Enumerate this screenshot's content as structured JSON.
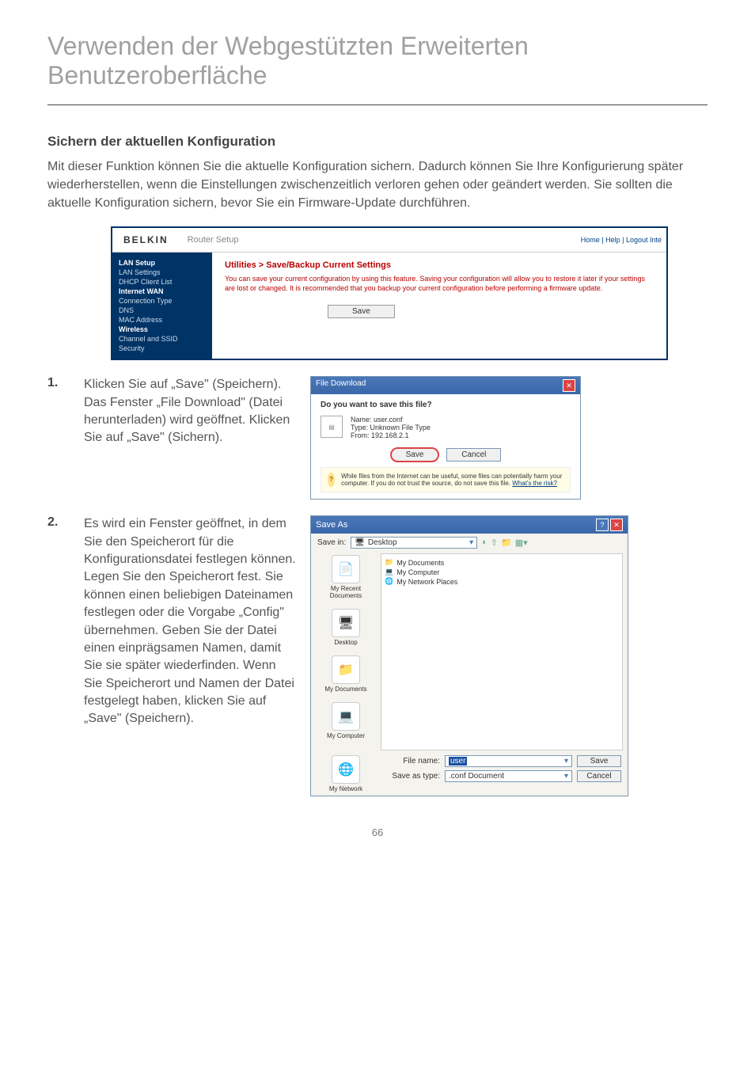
{
  "title_line1": "Verwenden der Webgestützten Erweiterten",
  "title_line2": "Benutzeroberfläche",
  "section_heading": "Sichern der aktuellen Konfiguration",
  "intro": "Mit dieser Funktion können Sie die aktuelle Konfiguration sichern. Dadurch können Sie Ihre Konfigurierung später wiederherstellen, wenn die Einstellungen zwischenzeitlich verloren gehen oder geändert werden. Sie sollten die aktuelle Konfiguration sichern, bevor Sie ein Firmware-Update durchführen.",
  "router": {
    "logo": "BELKIN",
    "title": "Router Setup",
    "links": "Home | Help | Logout    Inte",
    "side": {
      "hd1": "LAN Setup",
      "i1": "LAN Settings",
      "i2": "DHCP Client List",
      "hd2": "Internet WAN",
      "i3": "Connection Type",
      "i4": "DNS",
      "i5": "MAC Address",
      "hd3": "Wireless",
      "i6": "Channel and SSID",
      "i7": "Security"
    },
    "panel_title": "Utilities > Save/Backup Current Settings",
    "panel_text": "You can save your current configuration by using this feature. Saving your configuration will allow you to restore it later if your settings are lost or changed. It is recommended that you backup your current configuration before performing a firmware update.",
    "save": "Save"
  },
  "step1_num": "1.",
  "step1": "Klicken Sie auf „Save\" (Speichern). Das Fenster „File Download\" (Datei herunterladen) wird geöffnet. Klicken Sie auf „Save\" (Sichern).",
  "fdl": {
    "title": "File Download",
    "question": "Do you want to save this file?",
    "name_lbl": "Name:",
    "name_val": "user.conf",
    "type_lbl": "Type:",
    "type_val": "Unknown File Type",
    "from_lbl": "From:",
    "from_val": "192.168.2.1",
    "save": "Save",
    "cancel": "Cancel",
    "warn": "While files from the Internet can be useful, some files can potentially harm your computer. If you do not trust the source, do not save this file.",
    "warn_link": "What's the risk?"
  },
  "step2_num": "2.",
  "step2": "Es wird ein Fenster geöffnet, in dem Sie den Speicherort für die Konfigurationsdatei festlegen können. Legen Sie den Speicherort fest. Sie können einen beliebigen Dateinamen festlegen oder die Vorgabe „Config\" übernehmen. Geben Sie der Datei einen einprägsamen Namen, damit Sie sie später wiederfinden. Wenn Sie Speicherort und Namen der Datei festgelegt haben, klicken Sie auf „Save\" (Speichern).",
  "saveas": {
    "title": "Save As",
    "savein_lbl": "Save in:",
    "savein_val": "Desktop",
    "itm1": "My Documents",
    "itm2": "My Computer",
    "itm3": "My Network Places",
    "p1": "My Recent Documents",
    "p2": "Desktop",
    "p3": "My Documents",
    "p4": "My Computer",
    "p5": "My Network",
    "fn_lbl": "File name:",
    "fn_val": "user",
    "ft_lbl": "Save as type:",
    "ft_val": ".conf Document",
    "save": "Save",
    "cancel": "Cancel"
  },
  "pagenum": "66"
}
